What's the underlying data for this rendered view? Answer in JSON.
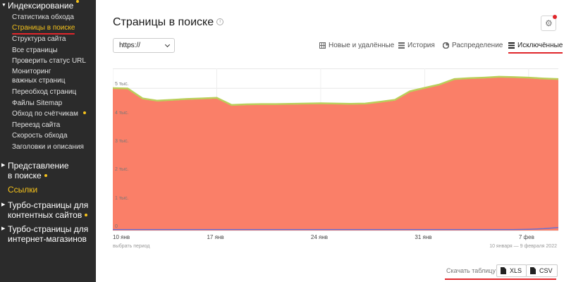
{
  "sidebar": {
    "sections": [
      {
        "label": "Индексирование",
        "dot": true,
        "top": 0
      },
      {
        "label1": "Представление",
        "label2": "в поиске",
        "dot": true
      },
      {
        "label": "Ссылки"
      },
      {
        "label1": "Турбо-страницы для",
        "label2": "контентных сайтов",
        "dot": true
      },
      {
        "label1": "Турбо-страницы для",
        "label2": "интернет-магазинов"
      }
    ],
    "items": [
      "Статистика обхода",
      "Страницы в поиске",
      "Структура сайта",
      "Все страницы",
      "Проверить статус URL",
      "Мониторинг",
      "важных страниц",
      "Переобход страниц",
      "Файлы Sitemap",
      "Обход по счётчикам",
      "Переезд сайта",
      "Скорость обхода",
      "Заголовки и описания"
    ]
  },
  "header": {
    "title": "Страницы в поиске",
    "info_glyph": "i",
    "gear_glyph": "⚙"
  },
  "filter": {
    "protocol": "https://"
  },
  "tabs": [
    {
      "label": "Новые и удалённые",
      "icon": "table-icon"
    },
    {
      "label": "История",
      "icon": "list-icon"
    },
    {
      "label": "Распределение",
      "icon": "pie-icon"
    },
    {
      "label": "Исключённые",
      "icon": "stack-icon",
      "active": true
    }
  ],
  "colors": {
    "accent_red": "#e0262b",
    "highlight_yellow": "#f5c21b",
    "area_fill": "#fa7f68",
    "area_top_line": "#b9cf5a",
    "low_series": "#6a6fd0"
  },
  "chart_data": {
    "type": "area",
    "y_tick_labels": [
      "0",
      "1 тыс.",
      "2 тыс.",
      "3 тыс.",
      "4 тыс.",
      "5 тыс."
    ],
    "ylim": [
      0,
      5700
    ],
    "x_tick_labels": [
      "10 янв",
      "17 янв",
      "24 янв",
      "31 янв",
      "7 фев"
    ],
    "x": [
      "10 янв",
      "11 янв",
      "12 янв",
      "13 янв",
      "14 янв",
      "15 янв",
      "16 янв",
      "17 янв",
      "18 янв",
      "19 янв",
      "20 янв",
      "21 янв",
      "22 янв",
      "23 янв",
      "24 янв",
      "25 янв",
      "26 янв",
      "27 янв",
      "28 янв",
      "29 янв",
      "30 янв",
      "31 янв",
      "1 фев",
      "2 фев",
      "3 фев",
      "4 фев",
      "5 фев",
      "6 фев",
      "7 фев",
      "8 фев",
      "9 фев"
    ],
    "series": [
      {
        "values": [
          4980,
          4970,
          4620,
          4540,
          4570,
          4600,
          4620,
          4640,
          4390,
          4410,
          4420,
          4420,
          4430,
          4440,
          4450,
          4440,
          4430,
          4440,
          4500,
          4570,
          4870,
          4990,
          5110,
          5300,
          5330,
          5350,
          5380,
          5370,
          5350,
          5320,
          5300
        ]
      },
      {
        "values": [
          10,
          10,
          10,
          10,
          10,
          10,
          10,
          10,
          10,
          10,
          10,
          10,
          10,
          10,
          10,
          10,
          10,
          10,
          10,
          10,
          10,
          10,
          10,
          10,
          10,
          10,
          10,
          10,
          20,
          40,
          80
        ]
      }
    ]
  },
  "footer": {
    "period_link": "выбрать период",
    "period_range": "10 января — 9 февраля 2022",
    "download_label": "Скачать таблицу",
    "xls": "XLS",
    "csv": "CSV"
  }
}
